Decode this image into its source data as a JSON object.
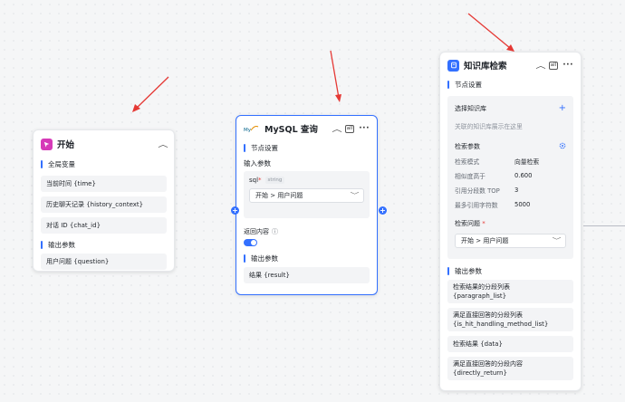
{
  "start_node": {
    "title": "开始",
    "global_vars_label": "全局变量",
    "global_vars": [
      "当前时间 {time}",
      "历史聊天记录 {history_context}",
      "对话 ID {chat_id}"
    ],
    "output_label": "输出参数",
    "outputs": [
      "用户问题 {question}"
    ]
  },
  "mysql_node": {
    "title": "MySQL 查询",
    "node_settings_label": "节点设置",
    "input_params_label": "输入参数",
    "param_name": "sql",
    "param_required_mark": "*",
    "param_type": "string",
    "param_select_value": "开始 > 用户问题",
    "return_content_label": "返回内容",
    "help_glyph": "ⓘ",
    "output_label": "输出参数",
    "outputs": [
      "结果 {result}"
    ]
  },
  "kb_node": {
    "title": "知识库检索",
    "node_settings_label": "节点设置",
    "select_kb_label": "选择知识库",
    "kb_placeholder": "关联的知识库展示在这里",
    "search_params_label": "检索参数",
    "params": [
      {
        "k": "检索模式",
        "v": "向量检索"
      },
      {
        "k": "相似度高于",
        "v": "0.600"
      },
      {
        "k": "引用分段数 TOP",
        "v": "3"
      },
      {
        "k": "最多引用字符数",
        "v": "5000"
      }
    ],
    "question_label": "检索问题",
    "question_required_mark": "*",
    "question_select_value": "开始 > 用户问题",
    "output_label": "输出参数",
    "outputs": [
      "检索结果的分段列表\n{paragraph_list}",
      "满足直接回答的分段列表\n{is_hit_handling_method_list}",
      "检索结果 {data}",
      "满足直接回答的分段内容\n{directly_return}"
    ]
  },
  "header_icons": {
    "collapse": "︿",
    "all": "all",
    "more": "···",
    "dropdown": "﹀",
    "plus": "+"
  },
  "colors": {
    "accent": "#3370ff",
    "arrow": "#e53935",
    "start_icon": "#d63ab8"
  }
}
